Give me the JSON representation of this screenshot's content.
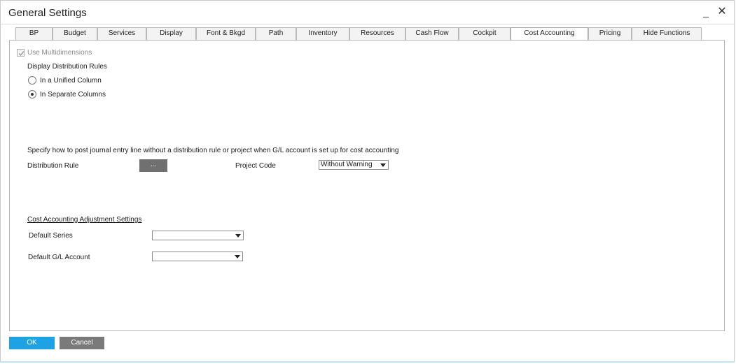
{
  "window": {
    "title": "General Settings",
    "minimize_label": "_",
    "close_label": "✕"
  },
  "tabs": [
    {
      "label": "BP"
    },
    {
      "label": "Budget"
    },
    {
      "label": "Services"
    },
    {
      "label": "Display"
    },
    {
      "label": "Font & Bkgd"
    },
    {
      "label": "Path"
    },
    {
      "label": "Inventory"
    },
    {
      "label": "Resources"
    },
    {
      "label": "Cash Flow"
    },
    {
      "label": "Cockpit"
    },
    {
      "label": "Cost Accounting",
      "active": true
    },
    {
      "label": "Pricing"
    },
    {
      "label": "Hide Functions"
    }
  ],
  "cost_accounting": {
    "use_multidimensions": {
      "label": "Use Multidimensions",
      "checked": true,
      "enabled": false
    },
    "display_rules_heading": "Display Distribution Rules",
    "radio_unified": {
      "label": "In a Unified Column",
      "selected": false
    },
    "radio_separate": {
      "label": "In Separate Columns",
      "selected": true
    },
    "post_instruction": "Specify how to post journal entry line without a distribution rule or project when G/L account is set up for cost accounting",
    "distribution_rule": {
      "label": "Distribution Rule",
      "button_label": "..."
    },
    "project_code": {
      "label": "Project Code",
      "value": "Without Warning"
    },
    "adjustment_heading": "Cost Accounting Adjustment Settings",
    "default_series": {
      "label": "Default Series",
      "value": ""
    },
    "default_gl_account": {
      "label": "Default G/L Account",
      "value": ""
    }
  },
  "footer": {
    "ok_label": "OK",
    "cancel_label": "Cancel"
  },
  "colors": {
    "ok_button": "#1ea2e3",
    "cancel_button": "#7a7a7a",
    "ellipsis_button": "#707070"
  }
}
